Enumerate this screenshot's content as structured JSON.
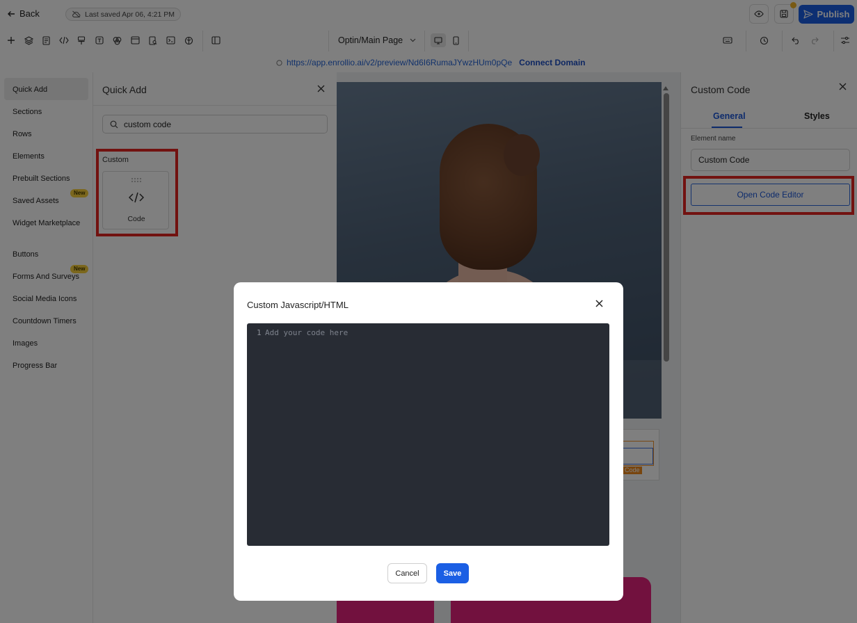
{
  "header": {
    "back_label": "Back",
    "last_saved": "Last saved Apr 06, 4:21 PM",
    "publish_label": "Publish"
  },
  "toolbar": {
    "page_select_value": "Optin/Main Page"
  },
  "urlbar": {
    "url": "https://app.enrollio.ai/v2/preview/Nd6I6RumaJYwzHUm0pQe",
    "connect_domain": "Connect Domain"
  },
  "leftnav": {
    "items": [
      {
        "label": "Quick Add"
      },
      {
        "label": "Sections"
      },
      {
        "label": "Rows"
      },
      {
        "label": "Elements"
      },
      {
        "label": "Prebuilt Sections"
      },
      {
        "label": "Saved Assets",
        "badge": "New"
      },
      {
        "label": "Widget Marketplace"
      },
      {
        "label": "Buttons"
      },
      {
        "label": "Forms And Surveys",
        "badge": "New"
      },
      {
        "label": "Social Media Icons"
      },
      {
        "label": "Countdown Timers"
      },
      {
        "label": "Images"
      },
      {
        "label": "Progress Bar"
      }
    ]
  },
  "quick_add": {
    "title": "Quick Add",
    "search_value": "custom code",
    "category": "Custom",
    "tile_label": "Code"
  },
  "canvas": {
    "custom_tag": "om Code"
  },
  "right_panel": {
    "title": "Custom Code",
    "tab_general": "General",
    "tab_styles": "Styles",
    "element_name_label": "Element name",
    "element_name_value": "Custom Code",
    "open_editor_label": "Open Code Editor"
  },
  "modal": {
    "title": "Custom Javascript/HTML",
    "line_number": "1",
    "placeholder": "Add your code here",
    "cancel_label": "Cancel",
    "save_label": "Save"
  },
  "colors": {
    "accent": "#1b5fe4",
    "highlight_red": "#e52421",
    "badge_yellow": "#f6cf3a",
    "editor_bg": "#282c34",
    "pink": "#e5227c"
  }
}
